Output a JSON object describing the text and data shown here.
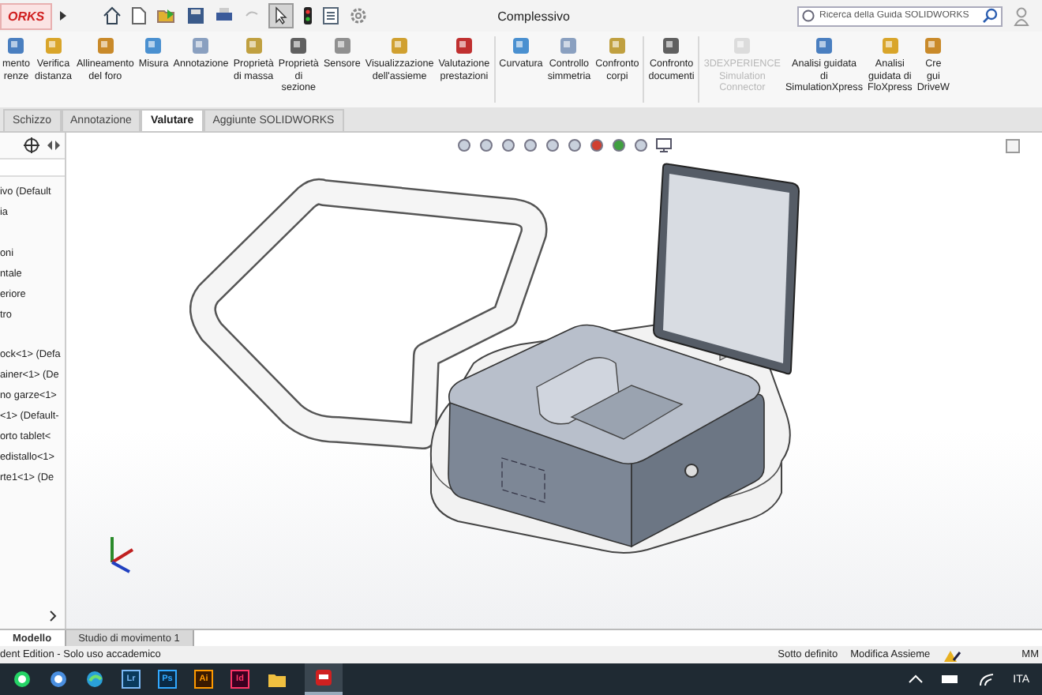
{
  "window": {
    "logo_text": "ORKS",
    "title": "Complessivo",
    "search": {
      "placeholder": "Ricerca della Guida SOLIDWORKS"
    }
  },
  "ribbon": {
    "groups": [
      [
        {
          "lines": [
            "mento",
            "renze"
          ],
          "disabled": false
        },
        {
          "lines": [
            "Verifica",
            "distanza"
          ],
          "disabled": false
        },
        {
          "lines": [
            "Allineamento",
            "del foro"
          ],
          "disabled": false
        },
        {
          "lines": [
            "Misura"
          ],
          "disabled": false
        },
        {
          "lines": [
            "Annotazione"
          ],
          "disabled": false
        },
        {
          "lines": [
            "Proprietà",
            "di massa"
          ],
          "disabled": false
        },
        {
          "lines": [
            "Proprietà",
            "di",
            "sezione"
          ],
          "disabled": false
        },
        {
          "lines": [
            "Sensore"
          ],
          "disabled": false
        },
        {
          "lines": [
            "Visualizzazione",
            "dell'assieme"
          ],
          "disabled": false
        },
        {
          "lines": [
            "Valutazione",
            "prestazioni"
          ],
          "disabled": false
        }
      ],
      [
        {
          "lines": [
            "Curvatura"
          ],
          "disabled": false
        },
        {
          "lines": [
            "Controllo",
            "simmetria"
          ],
          "disabled": false
        },
        {
          "lines": [
            "Confronto",
            "corpi"
          ],
          "disabled": false
        }
      ],
      [
        {
          "lines": [
            "Confronto",
            "documenti"
          ],
          "disabled": false
        }
      ],
      [
        {
          "lines": [
            "3DEXPERIENCE",
            "Simulation",
            "Connector"
          ],
          "disabled": true
        },
        {
          "lines": [
            "Analisi guidata",
            "di",
            "SimulationXpress"
          ],
          "disabled": false
        },
        {
          "lines": [
            "Analisi",
            "guidata di",
            "FloXpress"
          ],
          "disabled": false
        },
        {
          "lines": [
            "Cre",
            "gui",
            "DriveW"
          ],
          "disabled": false
        }
      ]
    ]
  },
  "tabs": [
    {
      "label": "Schizzo",
      "selected": false
    },
    {
      "label": "Annotazione",
      "selected": false
    },
    {
      "label": "Valutare",
      "selected": true
    },
    {
      "label": "Aggiunte SOLIDWORKS",
      "selected": false
    }
  ],
  "tree": {
    "label": "ivo  (Default",
    "children": [
      {
        "label": "ia"
      },
      {
        "label": "oni"
      },
      {
        "label": "ntale"
      },
      {
        "label": "eriore"
      },
      {
        "label": "tro"
      },
      {
        "label": "ock<1> (Defa"
      },
      {
        "label": "ainer<1> (De"
      },
      {
        "label": "no garze<1>"
      },
      {
        "label": "<1> (Default-"
      },
      {
        "label": "orto tablet<"
      },
      {
        "label": "edistallo<1>"
      },
      {
        "label": "rte1<1> (De"
      }
    ]
  },
  "bottom_tabs": [
    {
      "label": "Modello",
      "selected": true
    },
    {
      "label": "Studio di movimento 1",
      "selected": false
    }
  ],
  "status_bar": {
    "edition": "dent Edition - Solo uso accademico",
    "state": "Sotto definito",
    "mode": "Modifica Assieme",
    "units": "MM"
  },
  "taskbar": {
    "apps": [
      "Lr",
      "Ps",
      "Ai",
      "Id"
    ],
    "language": "ITA"
  }
}
